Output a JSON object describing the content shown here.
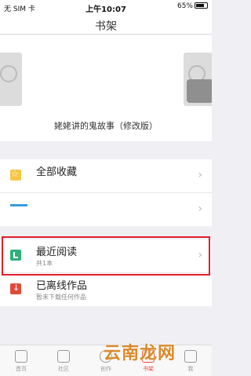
{
  "status_bar": {
    "carrier": "无 SIM 卡",
    "time": "上午10:07",
    "battery": "65%"
  },
  "header": {
    "title": "书架"
  },
  "featured_book": {
    "title": "姥姥讲的鬼故事（修改版）"
  },
  "shelf": [
    {
      "label": "全部收藏",
      "sub": ""
    },
    {
      "label": "",
      "sub": ""
    },
    {
      "label": "最近阅读",
      "sub": "共1本"
    },
    {
      "label": "已离线作品",
      "sub": "暂未下载任何作品"
    }
  ],
  "tab_bar": [
    {
      "label": "首页",
      "icon": "home-icon"
    },
    {
      "label": "社区",
      "icon": "community-icon"
    },
    {
      "label": "创作",
      "icon": "create-icon"
    },
    {
      "label": "书架",
      "icon": "bookshelf-icon",
      "active": true
    },
    {
      "label": "我",
      "icon": "profile-icon"
    }
  ],
  "watermark": "云南龙网",
  "colors": {
    "highlight": "#e0202a",
    "accent": "#f04d3c",
    "favorites_icon": "#f6c645",
    "recent_icon": "#2eb07a",
    "offline_icon": "#e04b3a"
  }
}
